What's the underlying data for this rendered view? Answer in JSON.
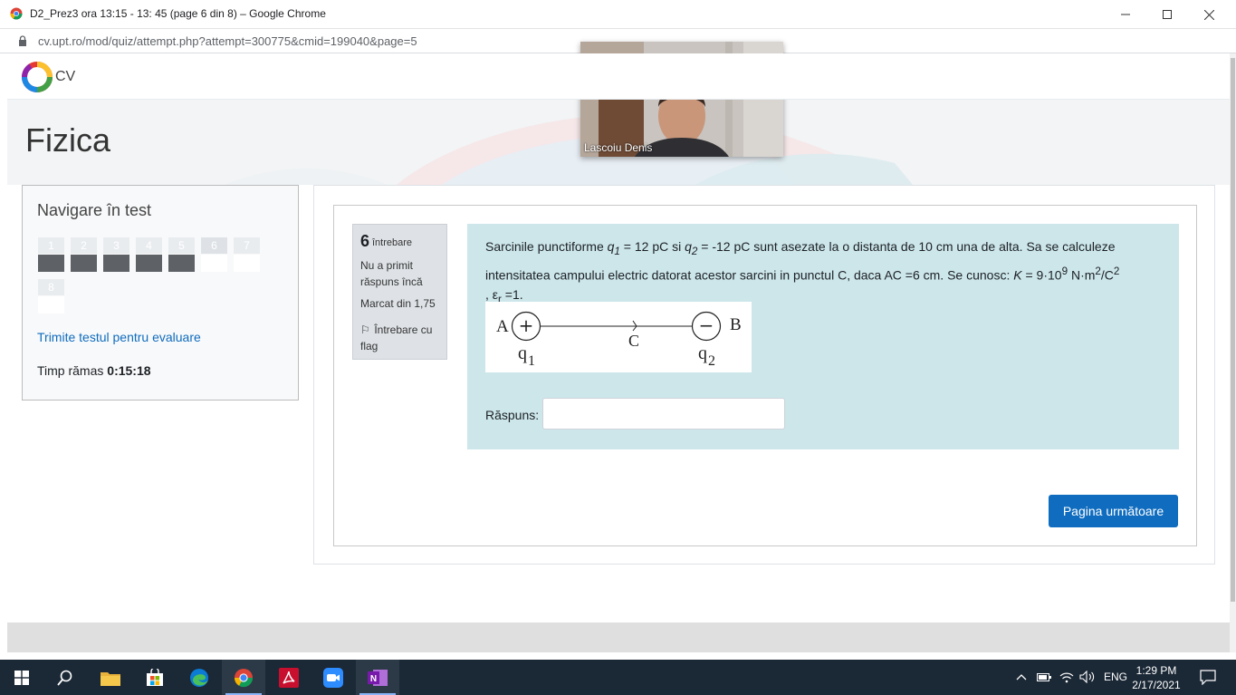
{
  "window": {
    "title": "D2_Prez3 ora 13:15 - 13: 45 (page 6 din 8) – Google Chrome",
    "url": "cv.upt.ro/mod/quiz/attempt.php?attempt=300775&cmid=199040&page=5"
  },
  "site": {
    "name": "CV",
    "course_title": "Fizica"
  },
  "video": {
    "participant_name": "Lascoiu Denis"
  },
  "nav": {
    "title": "Navigare în test",
    "questions": [
      {
        "label": "1",
        "state": "answered"
      },
      {
        "label": "2",
        "state": "answered"
      },
      {
        "label": "3",
        "state": "answered"
      },
      {
        "label": "4",
        "state": "answered"
      },
      {
        "label": "5",
        "state": "answered"
      },
      {
        "label": "6",
        "state": "current"
      },
      {
        "label": "7",
        "state": "not-answered"
      },
      {
        "label": "8",
        "state": "not-answered"
      }
    ],
    "finish_link": "Trimite testul pentru evaluare",
    "time_label": "Timp rămas",
    "time_value": "0:15:18"
  },
  "question": {
    "number": "6",
    "number_word": "întrebare",
    "state": "Nu a primit răspuns încă",
    "grade": "Marcat din 1,75",
    "flag_label": "Întrebare cu flag",
    "text_line1_a": "Sarcinile punctiforme ",
    "q1_symbol": "q",
    "q1_sub": "1",
    "q1_value": " = 12 pC si ",
    "q2_symbol": "q",
    "q2_sub": "2",
    "q2_value": " = -12 pC sunt asezate la o distanta de 10 cm una de alta. Sa se calculeze",
    "text_line2": "intensitatea campului electric datorat acestor sarcini  in punctul C, daca AC =6 cm. Se cunosc: ",
    "k_symbol": "K",
    "k_value": " = 9·10",
    "k_exp": "9",
    "k_unit": " N·m",
    "k_unit_exp": "2",
    "k_unit_den": "/C",
    "k_unit_den_exp": "2",
    "eps_prefix": ", ε",
    "eps_sub": "r",
    "eps_value": " =1.",
    "diagram": {
      "label_a": "A",
      "label_b": "B",
      "label_c": "C",
      "plus": "+",
      "minus": "−",
      "q1": "q",
      "q1_sub": "1",
      "q2": "q",
      "q2_sub": "2"
    },
    "answer_label": "Răspuns:",
    "answer_value": ""
  },
  "actions": {
    "next_page": "Pagina următoare"
  },
  "taskbar": {
    "language": "ENG",
    "time": "1:29 PM",
    "date": "2/17/2021",
    "apps": [
      "start-icon",
      "search-icon",
      "file-explorer-icon",
      "store-icon",
      "edge-icon",
      "chrome-icon",
      "acrobat-icon",
      "zoom-icon",
      "onenote-icon"
    ]
  },
  "colors": {
    "accent": "#0f6cbf",
    "question_bg": "#cce6ea",
    "taskbar": "#1b2836"
  }
}
